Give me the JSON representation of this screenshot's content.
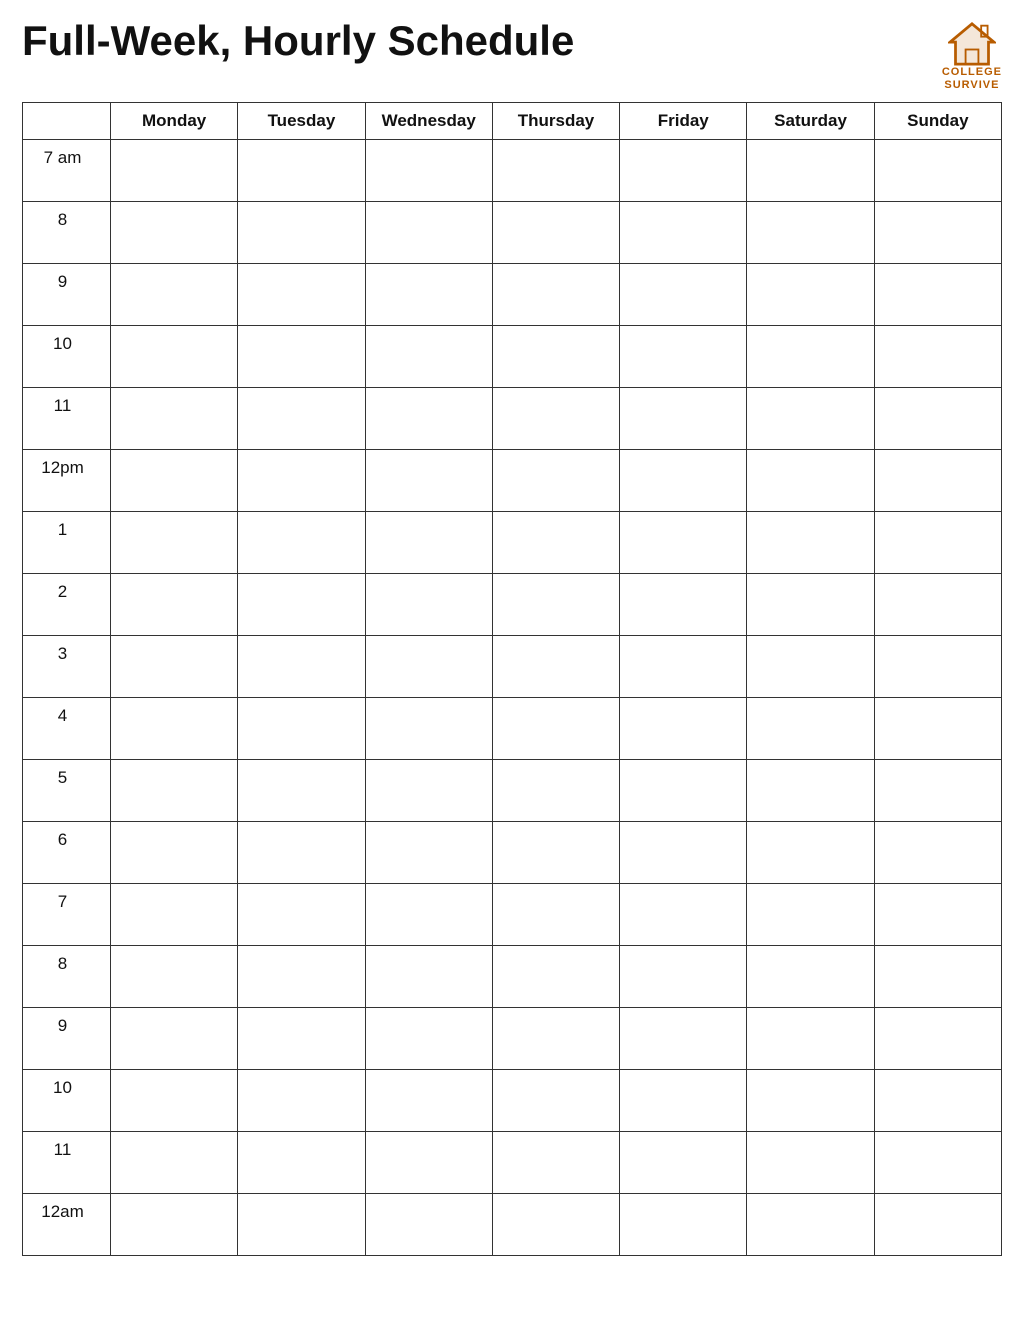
{
  "header": {
    "title": "Full-Week, Hourly Schedule",
    "logo_line1": "COLLEGE",
    "logo_line2": "SURVIVE"
  },
  "columns": {
    "time_header": "",
    "days": [
      "Monday",
      "Tuesday",
      "Wednesday",
      "Thursday",
      "Friday",
      "Saturday",
      "Sunday"
    ]
  },
  "time_slots": [
    "7 am",
    "8",
    "9",
    "10",
    "11",
    "12pm",
    "1",
    "2",
    "3",
    "4",
    "5",
    "6",
    "7",
    "8",
    "9",
    "10",
    "11",
    "12am"
  ],
  "brand_color": "#b85c00"
}
